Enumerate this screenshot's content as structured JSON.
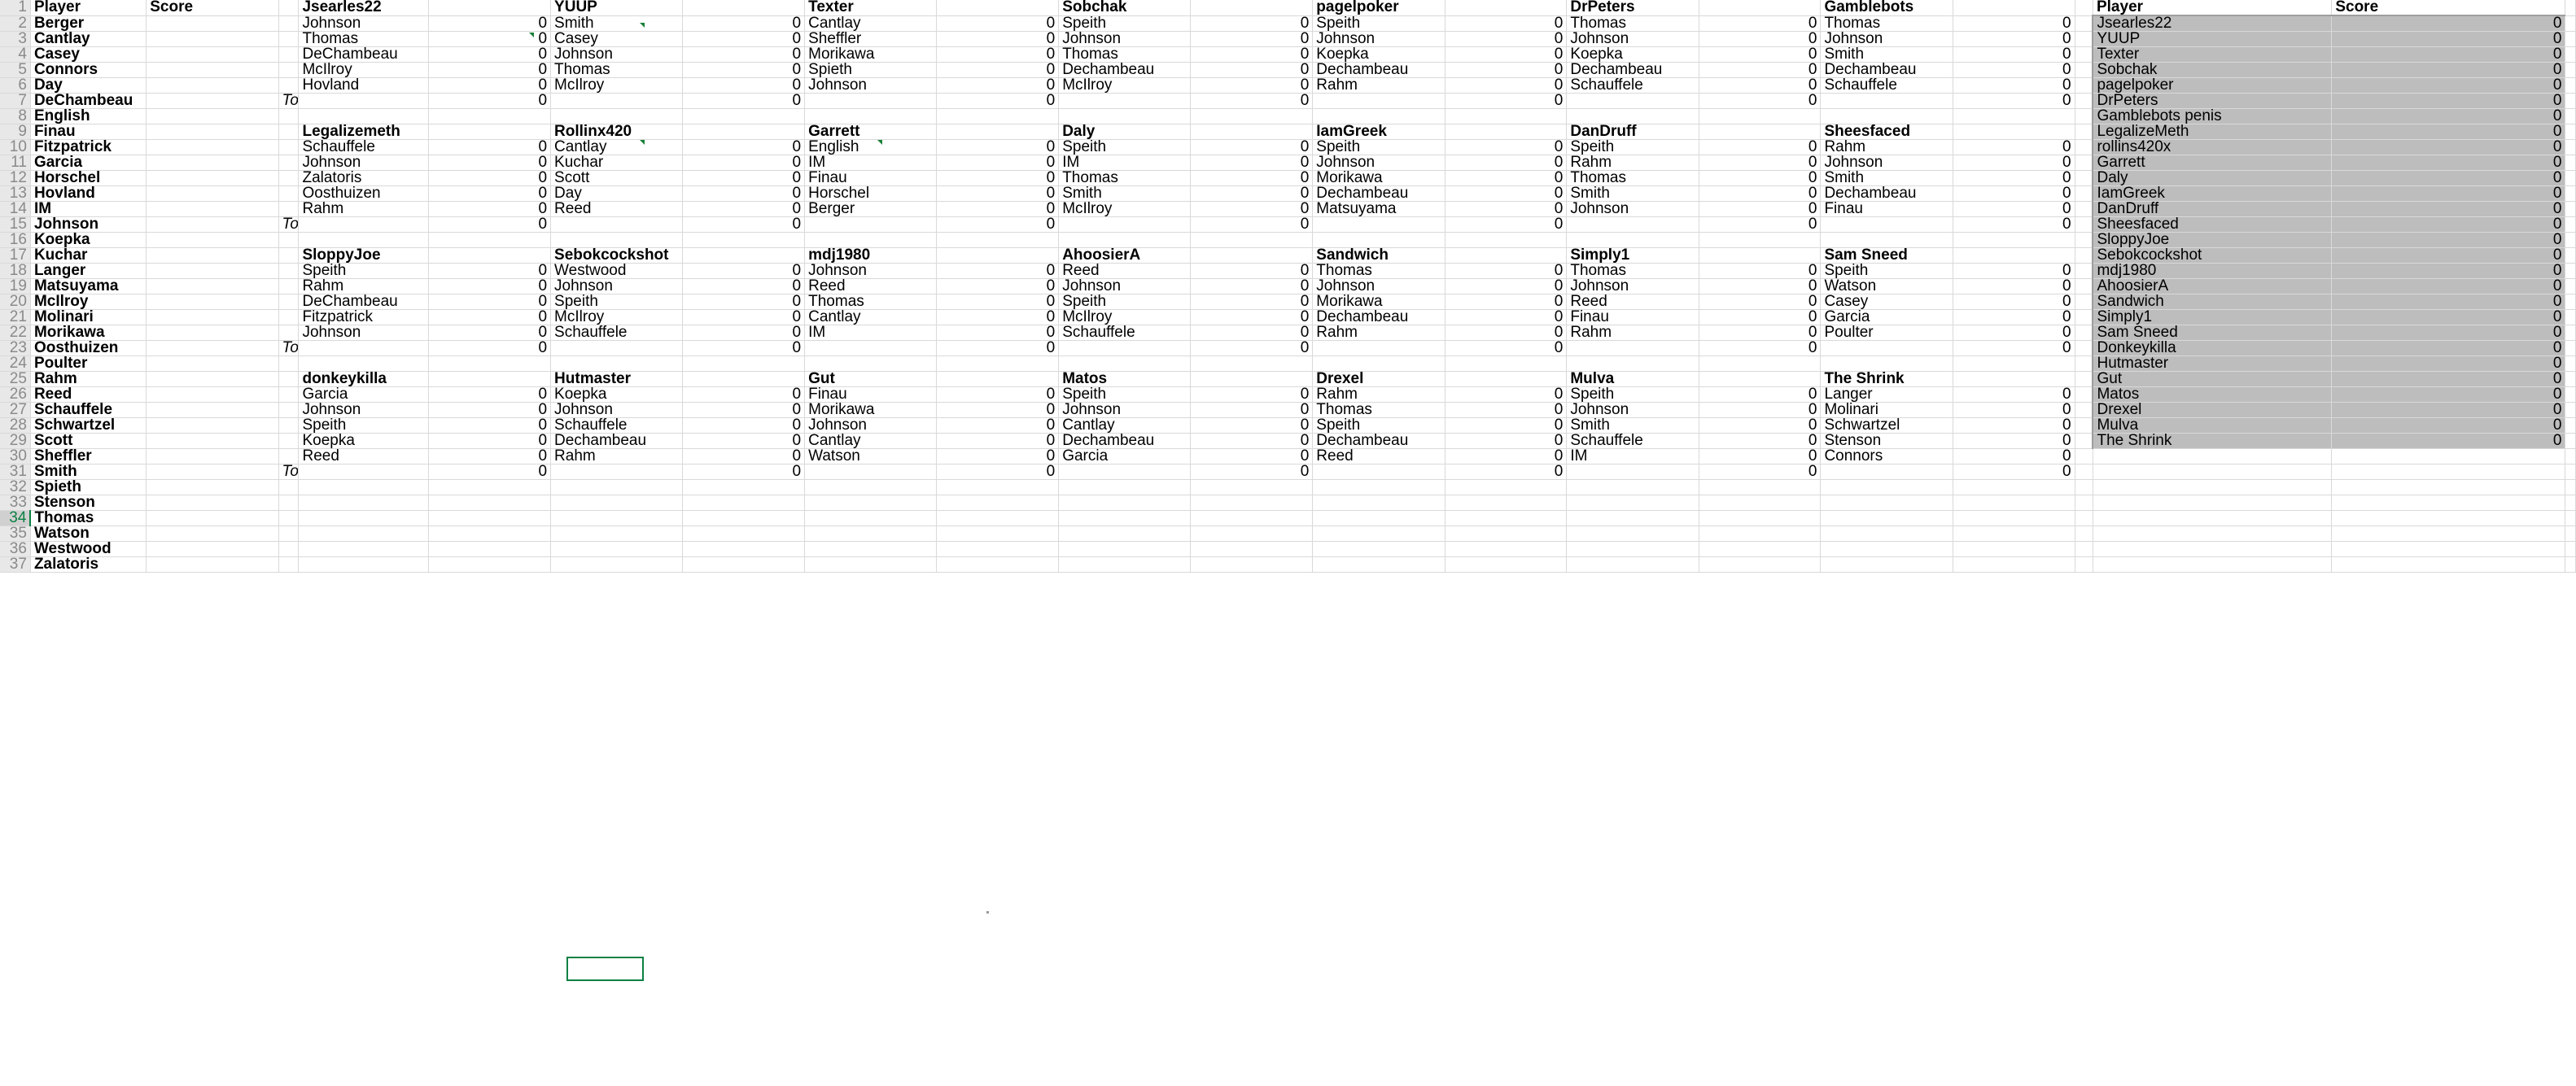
{
  "app": {
    "type": "spreadsheet"
  },
  "columns": {
    "widths": [
      30,
      114,
      130,
      20,
      128,
      120,
      130,
      120,
      130,
      120,
      130,
      120,
      130,
      120,
      130,
      120,
      130,
      120,
      18,
      235,
      230,
      10
    ]
  },
  "left_table": {
    "headers": {
      "player": "Player",
      "score": "Score"
    },
    "players": [
      "Berger",
      "Cantlay",
      "Casey",
      "Connors",
      "Day",
      "DeChambeau",
      "English",
      "Finau",
      "Fitzpatrick",
      "Garcia",
      "Horschel",
      "Hovland",
      "IM",
      "Johnson",
      "Koepka",
      "Kuchar",
      "Langer",
      "Matsuyama",
      "McIlroy",
      "Molinari",
      "Morikawa",
      "Oosthuizen",
      "Poulter",
      "Rahm",
      "Reed",
      "Schauffele",
      "Schwartzel",
      "Scott",
      "Sheffler",
      "Smith",
      "Spieth",
      "Stenson",
      "Thomas",
      "Watson",
      "Westwood",
      "Zalatoris"
    ]
  },
  "total_label": "Total",
  "zero": "0",
  "team_blocks": [
    {
      "header_row": 1,
      "teams": [
        {
          "name": "Jsearles22",
          "picks": [
            "Johnson",
            "Thomas",
            "DeChambeau",
            "McIlroy",
            "Hovland"
          ],
          "scores": [
            "0",
            "0",
            "0",
            "0",
            "0"
          ],
          "total": "0"
        },
        {
          "name": "YUUP",
          "picks": [
            "Smith",
            "Casey",
            "Johnson",
            "Thomas",
            "McIlroy"
          ],
          "scores": [
            "0",
            "0",
            "0",
            "0",
            "0"
          ],
          "total": "0"
        },
        {
          "name": "Texter",
          "picks": [
            "Cantlay",
            "Sheffler",
            "Morikawa",
            "Spieth",
            "Johnson"
          ],
          "scores": [
            "0",
            "0",
            "0",
            "0",
            "0"
          ],
          "total": "0"
        },
        {
          "name": "Sobchak",
          "picks": [
            "Speith",
            "Johnson",
            "Thomas",
            "Dechambeau",
            "McIlroy"
          ],
          "scores": [
            "0",
            "0",
            "0",
            "0",
            "0"
          ],
          "total": "0"
        },
        {
          "name": "pagelpoker",
          "picks": [
            "Speith",
            "Johnson",
            "Koepka",
            "Dechambeau",
            "Rahm"
          ],
          "scores": [
            "0",
            "0",
            "0",
            "0",
            "0"
          ],
          "total": "0"
        },
        {
          "name": "DrPeters",
          "picks": [
            "Thomas",
            "Johnson",
            "Koepka",
            "Dechambeau",
            "Schauffele"
          ],
          "scores": [
            "0",
            "0",
            "0",
            "0",
            "0"
          ],
          "total": "0"
        },
        {
          "name": "Gamblebots",
          "picks": [
            "Thomas",
            "Johnson",
            "Smith",
            "Dechambeau",
            "Schauffele"
          ],
          "scores": [
            "0",
            "0",
            "0",
            "0",
            "0"
          ],
          "total": "0"
        }
      ]
    },
    {
      "header_row": 9,
      "teams": [
        {
          "name": "Legalizemeth",
          "picks": [
            "Schauffele",
            "Johnson",
            "Zalatoris",
            "Oosthuizen",
            "Rahm"
          ],
          "scores": [
            "0",
            "0",
            "0",
            "0",
            "0"
          ],
          "total": "0"
        },
        {
          "name": "Rollinx420",
          "picks": [
            "Cantlay",
            "Kuchar",
            "Scott",
            "Day",
            "Reed"
          ],
          "scores": [
            "0",
            "0",
            "0",
            "0",
            "0"
          ],
          "total": "0"
        },
        {
          "name": "Garrett",
          "picks": [
            "English",
            "IM",
            "Finau",
            "Horschel",
            "Berger"
          ],
          "scores": [
            "0",
            "0",
            "0",
            "0",
            "0"
          ],
          "total": "0"
        },
        {
          "name": "Daly",
          "picks": [
            "Speith",
            "IM",
            "Thomas",
            "Smith",
            "McIlroy"
          ],
          "scores": [
            "0",
            "0",
            "0",
            "0",
            "0"
          ],
          "total": "0"
        },
        {
          "name": "IamGreek",
          "picks": [
            "Speith",
            "Johnson",
            "Morikawa",
            "Dechambeau",
            "Matsuyama"
          ],
          "scores": [
            "0",
            "0",
            "0",
            "0",
            "0"
          ],
          "total": "0"
        },
        {
          "name": "DanDruff",
          "picks": [
            "Speith",
            "Rahm",
            "Thomas",
            "Smith",
            "Johnson"
          ],
          "scores": [
            "0",
            "0",
            "0",
            "0",
            "0"
          ],
          "total": "0"
        },
        {
          "name": "Sheesfaced",
          "picks": [
            "Rahm",
            "Johnson",
            "Smith",
            "Dechambeau",
            "Finau"
          ],
          "scores": [
            "0",
            "0",
            "0",
            "0",
            "0"
          ],
          "total": "0"
        }
      ]
    },
    {
      "header_row": 17,
      "teams": [
        {
          "name": "SloppyJoe",
          "picks": [
            "Speith",
            "Rahm",
            "DeChambeau",
            "Fitzpatrick",
            "Johnson"
          ],
          "scores": [
            "0",
            "0",
            "0",
            "0",
            "0"
          ],
          "total": "0"
        },
        {
          "name": "Sebokcockshot",
          "picks": [
            "Westwood",
            "Johnson",
            "Speith",
            "McIlroy",
            "Schauffele"
          ],
          "scores": [
            "0",
            "0",
            "0",
            "0",
            "0"
          ],
          "total": "0"
        },
        {
          "name": "mdj1980",
          "picks": [
            "Johnson",
            "Reed",
            "Thomas",
            "Cantlay",
            "IM"
          ],
          "scores": [
            "0",
            "0",
            "0",
            "0",
            "0"
          ],
          "total": "0"
        },
        {
          "name": "AhoosierA",
          "picks": [
            "Reed",
            "Johnson",
            "Speith",
            "McIlroy",
            "Schauffele"
          ],
          "scores": [
            "0",
            "0",
            "0",
            "0",
            "0"
          ],
          "total": "0"
        },
        {
          "name": "Sandwich",
          "picks": [
            "Thomas",
            "Johnson",
            "Morikawa",
            "Dechambeau",
            "Rahm"
          ],
          "scores": [
            "0",
            "0",
            "0",
            "0",
            "0"
          ],
          "total": "0"
        },
        {
          "name": "Simply1",
          "picks": [
            "Thomas",
            "Johnson",
            "Reed",
            "Finau",
            "Rahm"
          ],
          "scores": [
            "0",
            "0",
            "0",
            "0",
            "0"
          ],
          "total": "0"
        },
        {
          "name": "Sam Sneed",
          "picks": [
            "Speith",
            "Watson",
            "Casey",
            "Garcia",
            "Poulter"
          ],
          "scores": [
            "0",
            "0",
            "0",
            "0",
            "0"
          ],
          "total": "0"
        }
      ]
    },
    {
      "header_row": 25,
      "teams": [
        {
          "name": "donkeykilla",
          "picks": [
            "Garcia",
            "Johnson",
            "Speith",
            "Koepka",
            "Reed"
          ],
          "scores": [
            "0",
            "0",
            "0",
            "0",
            "0"
          ],
          "total": "0"
        },
        {
          "name": "Hutmaster",
          "picks": [
            "Koepka",
            "Johnson",
            "Schauffele",
            "Dechambeau",
            "Rahm"
          ],
          "scores": [
            "0",
            "0",
            "0",
            "0",
            "0"
          ],
          "total": "0"
        },
        {
          "name": "Gut",
          "picks": [
            "Finau",
            "Morikawa",
            "Johnson",
            "Cantlay",
            "Watson"
          ],
          "scores": [
            "0",
            "0",
            "0",
            "0",
            "0"
          ],
          "total": "0"
        },
        {
          "name": "Matos",
          "picks": [
            "Speith",
            "Johnson",
            "Cantlay",
            "Dechambeau",
            "Garcia"
          ],
          "scores": [
            "0",
            "0",
            "0",
            "0",
            "0"
          ],
          "total": "0"
        },
        {
          "name": "Drexel",
          "picks": [
            "Rahm",
            "Thomas",
            "Speith",
            "Dechambeau",
            "Reed"
          ],
          "scores": [
            "0",
            "0",
            "0",
            "0",
            "0"
          ],
          "total": "0"
        },
        {
          "name": "Mulva",
          "picks": [
            "Speith",
            "Johnson",
            "Smith",
            "Schauffele",
            "IM"
          ],
          "scores": [
            "0",
            "0",
            "0",
            "0",
            "0"
          ],
          "total": "0"
        },
        {
          "name": "The Shrink",
          "picks": [
            "Langer",
            "Molinari",
            "Schwartzel",
            "Stenson",
            "Connors"
          ],
          "scores": [
            "0",
            "0",
            "0",
            "0",
            "0"
          ],
          "total": "0"
        }
      ]
    }
  ],
  "right_panel": {
    "headers": {
      "player": "Player",
      "score": "Score"
    },
    "rows": [
      {
        "name": "Jsearles22",
        "score": "0"
      },
      {
        "name": "YUUP",
        "score": "0"
      },
      {
        "name": "Texter",
        "score": "0"
      },
      {
        "name": "Sobchak",
        "score": "0"
      },
      {
        "name": "pagelpoker",
        "score": "0"
      },
      {
        "name": "DrPeters",
        "score": "0"
      },
      {
        "name": "Gamblebots penis",
        "score": "0"
      },
      {
        "name": "LegalizeMeth",
        "score": "0"
      },
      {
        "name": "rollins420x",
        "score": "0"
      },
      {
        "name": "Garrett",
        "score": "0"
      },
      {
        "name": "Daly",
        "score": "0"
      },
      {
        "name": "IamGreek",
        "score": "0"
      },
      {
        "name": "DanDruff",
        "score": "0"
      },
      {
        "name": "Sheesfaced",
        "score": "0"
      },
      {
        "name": "SloppyJoe",
        "score": "0"
      },
      {
        "name": "Sebokcockshot",
        "score": "0"
      },
      {
        "name": "mdj1980",
        "score": "0"
      },
      {
        "name": "AhoosierA",
        "score": "0"
      },
      {
        "name": "Sandwich",
        "score": "0"
      },
      {
        "name": "Simply1",
        "score": "0"
      },
      {
        "name": "Sam Sneed",
        "score": "0"
      },
      {
        "name": "Donkeykilla",
        "score": "0"
      },
      {
        "name": "Hutmaster",
        "score": "0"
      },
      {
        "name": "Gut",
        "score": "0"
      },
      {
        "name": "Matos",
        "score": "0"
      },
      {
        "name": "Drexel",
        "score": "0"
      },
      {
        "name": "Mulva",
        "score": "0"
      },
      {
        "name": "The Shrink",
        "score": "0"
      }
    ]
  },
  "row_numbers": [
    "1",
    "2",
    "3",
    "4",
    "5",
    "6",
    "7",
    "8",
    "9",
    "10",
    "11",
    "12",
    "13",
    "14",
    "15",
    "16",
    "17",
    "18",
    "19",
    "20",
    "21",
    "22",
    "23",
    "24",
    "25",
    "26",
    "27",
    "28",
    "29",
    "30",
    "31",
    "32",
    "33",
    "34",
    "35",
    "36",
    "37"
  ],
  "active_row": "34",
  "colors": {
    "selection_fill": "#bdbdbd",
    "cursor_border": "#0b8043",
    "gridline": "#d9d9d9",
    "rowheader_bg": "#e8e8e8"
  }
}
